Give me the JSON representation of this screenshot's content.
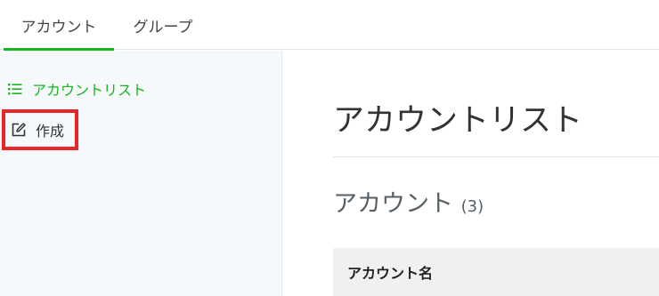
{
  "tabs": [
    {
      "label": "アカウント",
      "active": true
    },
    {
      "label": "グループ",
      "active": false
    }
  ],
  "sidebar": {
    "items": [
      {
        "label": "アカウントリスト",
        "icon": "list-icon",
        "active": true
      },
      {
        "label": "作成",
        "icon": "edit-icon",
        "highlighted": true
      }
    ]
  },
  "main": {
    "title": "アカウントリスト",
    "section_title": "アカウント",
    "section_count": "(3)",
    "table": {
      "columns": [
        "アカウント名"
      ]
    }
  },
  "colors": {
    "accent": "#17b41d",
    "highlight_border": "#e8262a",
    "sidebar_bg": "#f5f9fb",
    "table_header_bg": "#eef0f1"
  }
}
